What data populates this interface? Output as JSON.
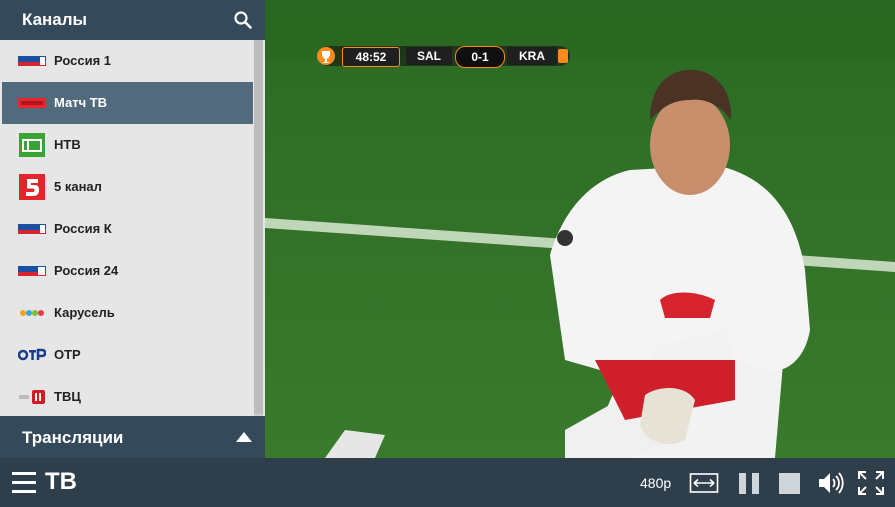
{
  "sidebar": {
    "title": "Каналы",
    "channels": [
      {
        "name": "Россия 1",
        "logo": "russia1-logo",
        "active": false
      },
      {
        "name": "Матч ТВ",
        "logo": "match-tv-logo",
        "active": true
      },
      {
        "name": "НТВ",
        "logo": "ntv-logo",
        "active": false
      },
      {
        "name": "5 канал",
        "logo": "channel5-logo",
        "active": false
      },
      {
        "name": "Россия К",
        "logo": "russia-k-logo",
        "active": false
      },
      {
        "name": "Россия 24",
        "logo": "russia24-logo",
        "active": false
      },
      {
        "name": "Карусель",
        "logo": "karusel-logo",
        "active": false
      },
      {
        "name": "ОТР",
        "logo": "otr-logo",
        "active": false
      },
      {
        "name": "ТВЦ",
        "logo": "tvc-logo",
        "active": false
      }
    ],
    "footer_title": "Трансляции"
  },
  "scorebug": {
    "clock": "48:52",
    "home": "SAL",
    "score": "0-1",
    "away": "KRA"
  },
  "bottom_bar": {
    "title": "ТВ",
    "quality": "480p"
  },
  "colors": {
    "panel": "#34495a",
    "bar": "#2f3e4b",
    "active_row": "#516b7c",
    "list_bg": "#e6e6e6",
    "accent_orange": "#ff8a1c"
  }
}
